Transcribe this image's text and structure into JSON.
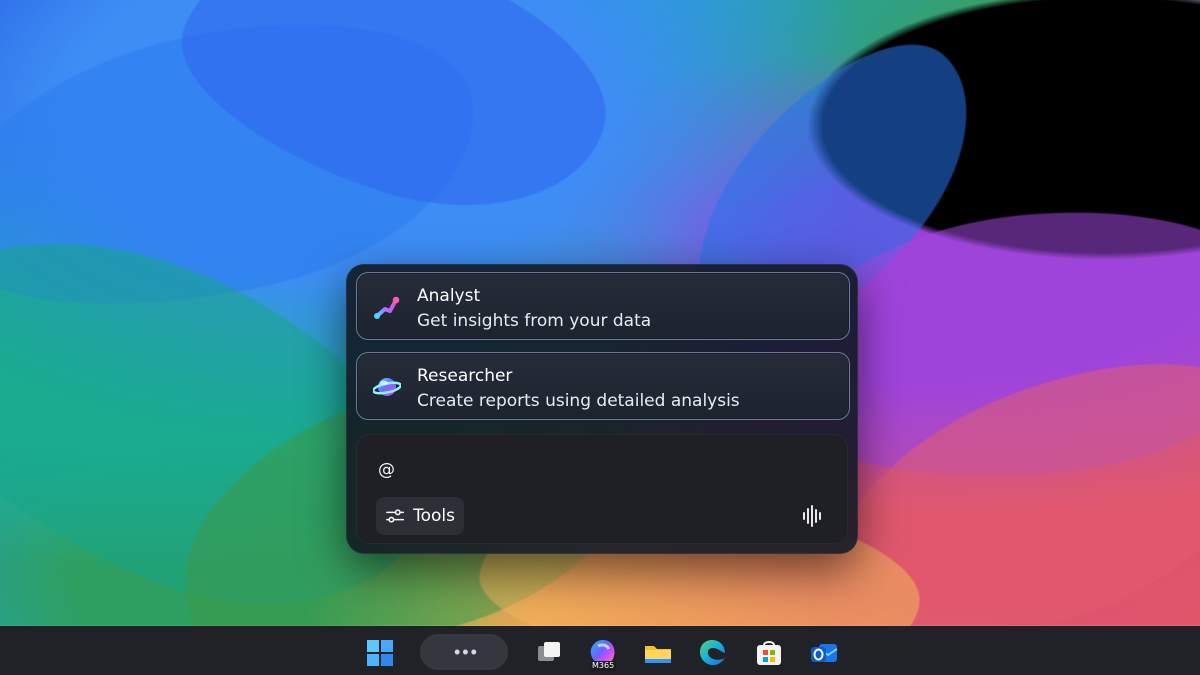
{
  "copilot": {
    "agents": [
      {
        "title": "Analyst",
        "description": "Get insights from your data",
        "icon": "analyst-icon"
      },
      {
        "title": "Researcher",
        "description": "Create reports using detailed analysis",
        "icon": "researcher-icon"
      }
    ],
    "prompt": {
      "value": "@",
      "placeholder": ""
    },
    "tools_label": "Tools",
    "icons": {
      "tools": "sliders-icon",
      "voice": "audio-waveform-icon"
    }
  },
  "taskbar": {
    "items": [
      {
        "name": "windows-start",
        "icon": "windows-logo-icon"
      },
      {
        "name": "search",
        "icon": "dots-icon"
      },
      {
        "name": "task-view",
        "icon": "task-view-icon"
      },
      {
        "name": "microsoft-365-copilot",
        "icon": "m365-copilot-icon",
        "badge": "M365"
      },
      {
        "name": "file-explorer",
        "icon": "folder-icon"
      },
      {
        "name": "edge",
        "icon": "edge-icon"
      },
      {
        "name": "microsoft-store",
        "icon": "store-icon"
      },
      {
        "name": "outlook",
        "icon": "outlook-icon"
      }
    ]
  },
  "colors": {
    "accent_blue": "#3e8df5",
    "panel_bg": "#121824",
    "taskbar_bg": "#17191e",
    "card_border": "#8296be"
  }
}
